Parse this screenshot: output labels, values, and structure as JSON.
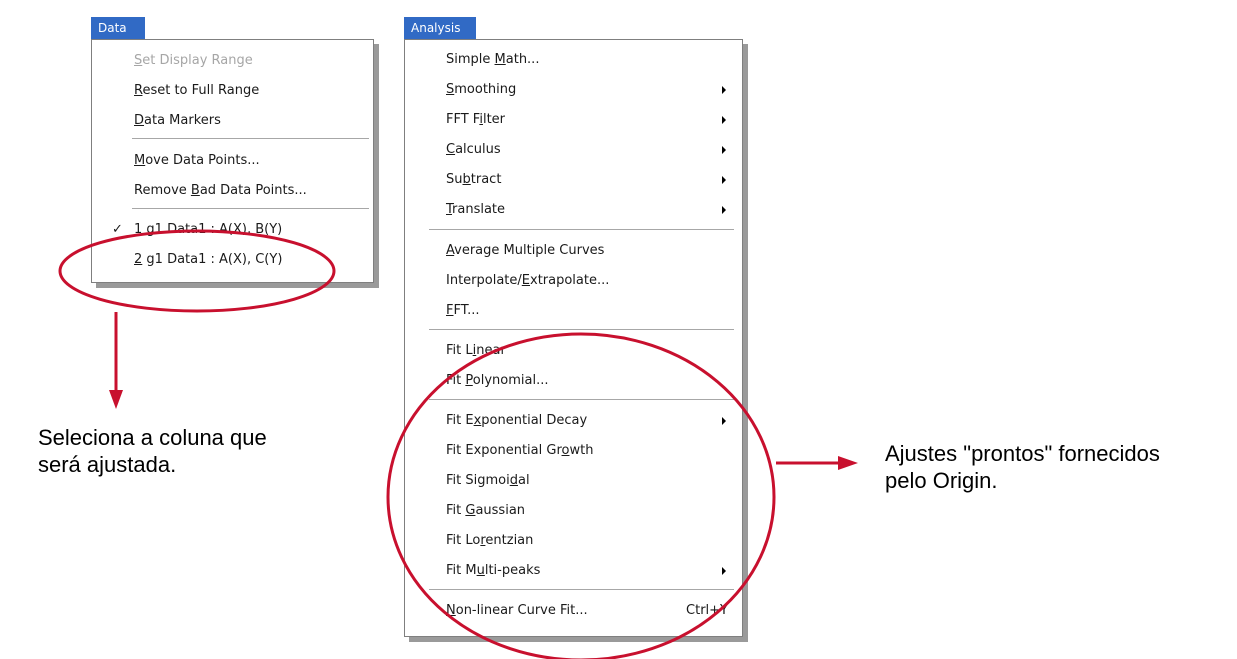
{
  "data_menu": {
    "title": "Data",
    "items": [
      {
        "pre": "",
        "mnemonic": "S",
        "post": "et Display Range",
        "disabled": true
      },
      {
        "pre": "",
        "mnemonic": "R",
        "post": "eset to Full Range"
      },
      {
        "pre": "",
        "mnemonic": "D",
        "post": "ata Markers"
      },
      {
        "pre": "",
        "mnemonic": "M",
        "post": "ove Data Points..."
      },
      {
        "pre": "Remove ",
        "mnemonic": "B",
        "post": "ad Data Points..."
      },
      {
        "pre": "",
        "mnemonic": "1",
        "post": " g1 Data1 : A(X), B(Y)",
        "checked": true
      },
      {
        "pre": "",
        "mnemonic": "2",
        "post": " g1 Data1 : A(X), C(Y)"
      }
    ]
  },
  "analysis_menu": {
    "title": "Analysis",
    "items": [
      {
        "pre": "Simple ",
        "mnemonic": "M",
        "post": "ath..."
      },
      {
        "pre": "",
        "mnemonic": "S",
        "post": "moothing",
        "submenu": true
      },
      {
        "pre": "FFT F",
        "mnemonic": "i",
        "post": "lter",
        "submenu": true
      },
      {
        "pre": "",
        "mnemonic": "C",
        "post": "alculus",
        "submenu": true
      },
      {
        "pre": "Su",
        "mnemonic": "b",
        "post": "tract",
        "submenu": true
      },
      {
        "pre": "",
        "mnemonic": "T",
        "post": "ranslate",
        "submenu": true
      },
      {
        "pre": "",
        "mnemonic": "A",
        "post": "verage Multiple Curves"
      },
      {
        "pre": "Interpolate/",
        "mnemonic": "E",
        "post": "xtrapolate..."
      },
      {
        "pre": "",
        "mnemonic": "F",
        "post": "FT..."
      },
      {
        "pre": "Fit L",
        "mnemonic": "i",
        "post": "near"
      },
      {
        "pre": "Fit ",
        "mnemonic": "P",
        "post": "olynomial..."
      },
      {
        "pre": "Fit E",
        "mnemonic": "x",
        "post": "ponential Decay",
        "submenu": true
      },
      {
        "pre": "Fit Exponential Gr",
        "mnemonic": "o",
        "post": "wth"
      },
      {
        "pre": "Fit Sigmoi",
        "mnemonic": "d",
        "post": "al"
      },
      {
        "pre": "Fit ",
        "mnemonic": "G",
        "post": "aussian"
      },
      {
        "pre": "Fit Lo",
        "mnemonic": "r",
        "post": "entzian"
      },
      {
        "pre": "Fit M",
        "mnemonic": "u",
        "post": "lti-peaks",
        "submenu": true
      },
      {
        "pre": "",
        "mnemonic": "N",
        "post": "on-linear Curve Fit...",
        "shortcut": "Ctrl+Y"
      }
    ]
  },
  "annotations": {
    "left_line1": "Seleciona a coluna que",
    "left_line2": "será ajustada.",
    "right_line1": "Ajustes \"prontos\" fornecidos",
    "right_line2": "pelo Origin."
  },
  "colors": {
    "menu_highlight": "#316ac5",
    "annotation_red": "#c8102e"
  }
}
